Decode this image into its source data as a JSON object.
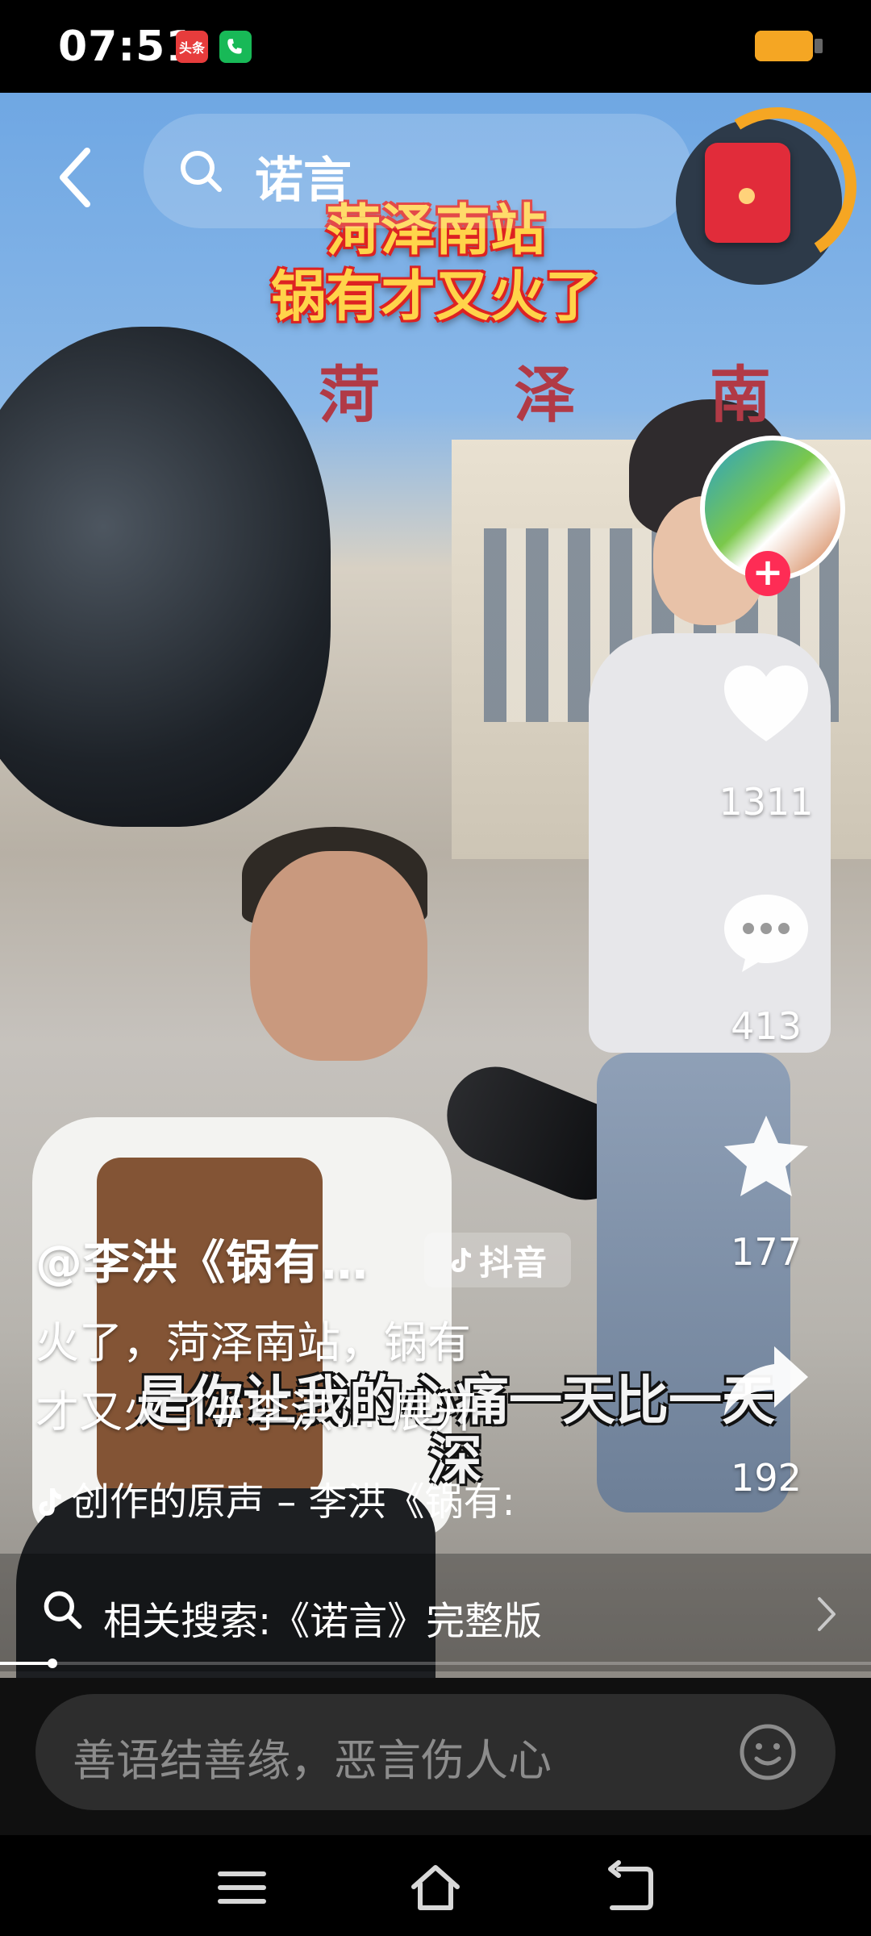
{
  "status_bar": {
    "time": "07:51",
    "app_icons": [
      {
        "name": "toutiao",
        "label": "头条",
        "color": "#e73c3c"
      },
      {
        "name": "phone",
        "label": "",
        "color": "#18b957"
      }
    ],
    "battery_color": "#f5a623"
  },
  "search": {
    "query": "诺言"
  },
  "video": {
    "title_overlay": [
      "菏泽南站",
      "锅有才又火了"
    ],
    "background_sign": "菏 泽 南",
    "lyrics": "是你让我的心痛一天比一天深"
  },
  "actions": [
    {
      "name": "like",
      "count": "1311",
      "icon": "heart-icon"
    },
    {
      "name": "comment",
      "count": "413",
      "icon": "comment-icon"
    },
    {
      "name": "favorite",
      "count": "177",
      "icon": "star-icon"
    },
    {
      "name": "share",
      "count": "192",
      "icon": "share-icon"
    }
  ],
  "post": {
    "author": "@李洪《锅有…",
    "platform_badge": "抖音",
    "description_line1": "火了，菏泽南站，锅有",
    "description_line2": "才又火了#李洪… 展开",
    "music": "创作的原声 – 李洪《锅有:"
  },
  "related_search": {
    "text": "相关搜索:《诺言》完整版"
  },
  "progress": {
    "value": 0.06
  },
  "comment": {
    "placeholder": "善语结善缘，恶言伤人心"
  },
  "colors": {
    "accent": "#fe2c55",
    "title_yellow": "#ffd44a",
    "title_red": "#d22222"
  }
}
